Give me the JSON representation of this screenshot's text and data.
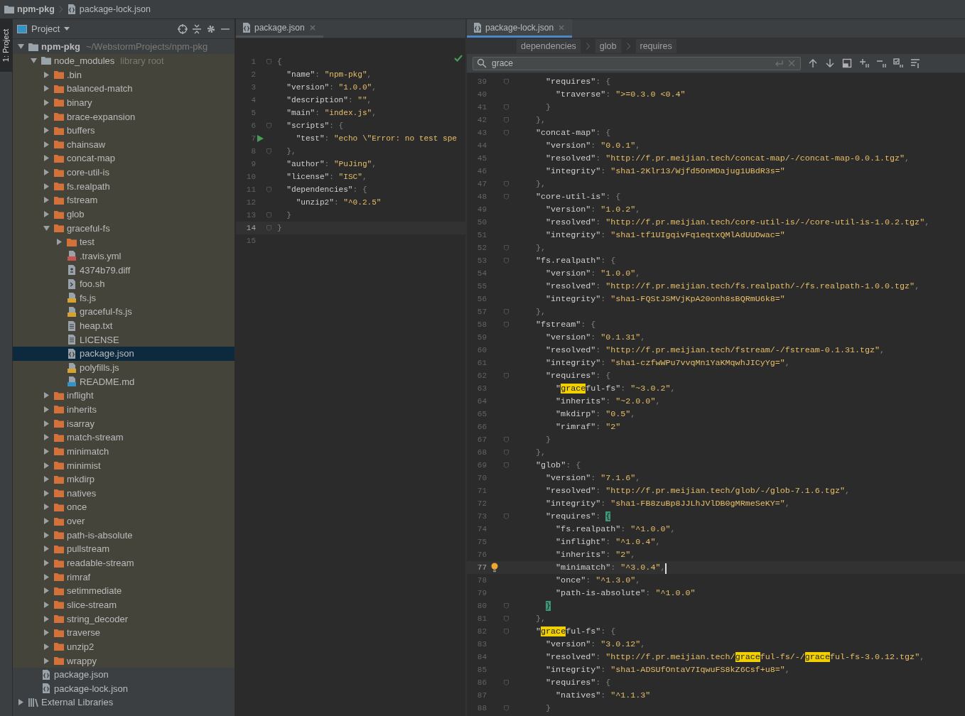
{
  "navigation_bar": {
    "items": [
      {
        "label": "npm-pkg",
        "kind": "folder"
      },
      {
        "label": "package-lock.json",
        "kind": "json"
      }
    ]
  },
  "tool_window_strip": {
    "label": "1: Project",
    "selected": true
  },
  "project_panel": {
    "title": "Project",
    "tree": [
      {
        "name": "npm-pkg",
        "hint": "~/WebstormProjects/npm-pkg",
        "kind": "project_folder",
        "expanded": true,
        "selected": false,
        "children": [
          {
            "name": "node_modules",
            "hint": "library root",
            "kind": "project_folder",
            "library": true,
            "expanded": true,
            "selected": false,
            "children": [
              {
                "name": ".bin",
                "kind": "folder",
                "expanded": false,
                "selected": false
              },
              {
                "name": "balanced-match",
                "kind": "folder",
                "expanded": false,
                "selected": false
              },
              {
                "name": "binary",
                "kind": "folder",
                "expanded": false,
                "selected": false
              },
              {
                "name": "brace-expansion",
                "kind": "folder",
                "expanded": false,
                "selected": false
              },
              {
                "name": "buffers",
                "kind": "folder",
                "expanded": false,
                "selected": false
              },
              {
                "name": "chainsaw",
                "kind": "folder",
                "expanded": false,
                "selected": false
              },
              {
                "name": "concat-map",
                "kind": "folder",
                "expanded": false,
                "selected": false
              },
              {
                "name": "core-util-is",
                "kind": "folder",
                "expanded": false,
                "selected": false
              },
              {
                "name": "fs.realpath",
                "kind": "folder",
                "expanded": false,
                "selected": false
              },
              {
                "name": "fstream",
                "kind": "folder",
                "expanded": false,
                "selected": false
              },
              {
                "name": "glob",
                "kind": "folder",
                "expanded": false,
                "selected": false
              },
              {
                "name": "graceful-fs",
                "kind": "folder",
                "expanded": true,
                "selected": false,
                "children": [
                  {
                    "name": "test",
                    "kind": "folder",
                    "expanded": false,
                    "selected": false
                  },
                  {
                    "name": ".travis.yml",
                    "kind": "yml",
                    "selected": false
                  },
                  {
                    "name": "4374b79.diff",
                    "kind": "diff",
                    "selected": false
                  },
                  {
                    "name": "foo.sh",
                    "kind": "shell",
                    "selected": false
                  },
                  {
                    "name": "fs.js",
                    "kind": "js",
                    "selected": false
                  },
                  {
                    "name": "graceful-fs.js",
                    "kind": "js",
                    "selected": false
                  },
                  {
                    "name": "heap.txt",
                    "kind": "text",
                    "selected": false
                  },
                  {
                    "name": "LICENSE",
                    "kind": "text",
                    "selected": false
                  },
                  {
                    "name": "package.json",
                    "kind": "json",
                    "selected": true
                  },
                  {
                    "name": "polyfills.js",
                    "kind": "js",
                    "selected": false
                  },
                  {
                    "name": "README.md",
                    "kind": "md",
                    "selected": false
                  }
                ]
              },
              {
                "name": "inflight",
                "kind": "folder",
                "expanded": false,
                "selected": false
              },
              {
                "name": "inherits",
                "kind": "folder",
                "expanded": false,
                "selected": false
              },
              {
                "name": "isarray",
                "kind": "folder",
                "expanded": false,
                "selected": false
              },
              {
                "name": "match-stream",
                "kind": "folder",
                "expanded": false,
                "selected": false
              },
              {
                "name": "minimatch",
                "kind": "folder",
                "expanded": false,
                "selected": false
              },
              {
                "name": "minimist",
                "kind": "folder",
                "expanded": false,
                "selected": false
              },
              {
                "name": "mkdirp",
                "kind": "folder",
                "expanded": false,
                "selected": false
              },
              {
                "name": "natives",
                "kind": "folder",
                "expanded": false,
                "selected": false
              },
              {
                "name": "once",
                "kind": "folder",
                "expanded": false,
                "selected": false
              },
              {
                "name": "over",
                "kind": "folder",
                "expanded": false,
                "selected": false
              },
              {
                "name": "path-is-absolute",
                "kind": "folder",
                "expanded": false,
                "selected": false
              },
              {
                "name": "pullstream",
                "kind": "folder",
                "expanded": false,
                "selected": false
              },
              {
                "name": "readable-stream",
                "kind": "folder",
                "expanded": false,
                "selected": false
              },
              {
                "name": "rimraf",
                "kind": "folder",
                "expanded": false,
                "selected": false
              },
              {
                "name": "setimmediate",
                "kind": "folder",
                "expanded": false,
                "selected": false
              },
              {
                "name": "slice-stream",
                "kind": "folder",
                "expanded": false,
                "selected": false
              },
              {
                "name": "string_decoder",
                "kind": "folder",
                "expanded": false,
                "selected": false
              },
              {
                "name": "traverse",
                "kind": "folder",
                "expanded": false,
                "selected": false
              },
              {
                "name": "unzip2",
                "kind": "folder",
                "expanded": false,
                "selected": false
              },
              {
                "name": "wrappy",
                "kind": "folder",
                "expanded": false,
                "selected": false
              }
            ]
          },
          {
            "name": "package.json",
            "kind": "json",
            "selected": false
          },
          {
            "name": "package-lock.json",
            "kind": "json",
            "selected": false
          }
        ]
      },
      {
        "name": "External Libraries",
        "kind": "libraries",
        "expanded": false,
        "selected": false
      }
    ]
  },
  "editors": [
    {
      "tab": {
        "label": "package.json",
        "selected": false
      },
      "inspection_passed": true,
      "lines": [
        {
          "number": "1",
          "text": "{",
          "fold": true,
          "current": false
        },
        {
          "number": "2",
          "text": "  \"name\": \"npm-pkg\",",
          "current": false
        },
        {
          "number": "3",
          "text": "  \"version\": \"1.0.0\",",
          "current": false
        },
        {
          "number": "4",
          "text": "  \"description\": \"\",",
          "current": false
        },
        {
          "number": "5",
          "text": "  \"main\": \"index.js\",",
          "current": false
        },
        {
          "number": "6",
          "text": "  \"scripts\": {",
          "fold": true,
          "current": false
        },
        {
          "number": "7",
          "text": "    \"test\": \"echo \\\"Error: no test spe",
          "run_marker": true,
          "current": false
        },
        {
          "number": "8",
          "text": "  },",
          "fold": true,
          "current": false
        },
        {
          "number": "9",
          "text": "  \"author\": \"PuJing\",",
          "current": false
        },
        {
          "number": "10",
          "text": "  \"license\": \"ISC\",",
          "current": false
        },
        {
          "number": "11",
          "text": "  \"dependencies\": {",
          "fold": true,
          "current": false
        },
        {
          "number": "12",
          "text": "    \"unzip2\": \"^0.2.5\"",
          "current": false
        },
        {
          "number": "13",
          "text": "  }",
          "fold": true,
          "current": false
        },
        {
          "number": "14",
          "text": "}",
          "fold": true,
          "current": true
        },
        {
          "number": "15",
          "current": false
        }
      ]
    },
    {
      "tab": {
        "label": "package-lock.json",
        "selected": true
      },
      "breadcrumbs": [
        "dependencies",
        "glob",
        "requires"
      ],
      "search": {
        "value": "grace"
      },
      "lines": [
        {
          "number": "39",
          "text": "      \"requires\": {",
          "fold": true,
          "current": false
        },
        {
          "number": "40",
          "text": "        \"traverse\": \">=0.3.0 <0.4\"",
          "current": false
        },
        {
          "number": "41",
          "text": "      }",
          "fold": true,
          "current": false
        },
        {
          "number": "42",
          "text": "    },",
          "fold": true,
          "current": false
        },
        {
          "number": "43",
          "text": "    \"concat-map\": {",
          "fold": true,
          "current": false
        },
        {
          "number": "44",
          "text": "      \"version\": \"0.0.1\",",
          "current": false
        },
        {
          "number": "45",
          "text": "      \"resolved\": \"http://f.pr.meijian.tech/concat-map/-/concat-map-0.0.1.tgz\",",
          "current": false
        },
        {
          "number": "46",
          "text": "      \"integrity\": \"sha1-2Klr13/Wjfd5OnMDajug1UBdR3s=\"",
          "current": false
        },
        {
          "number": "47",
          "text": "    },",
          "fold": true,
          "current": false
        },
        {
          "number": "48",
          "text": "    \"core-util-is\": {",
          "fold": true,
          "current": false
        },
        {
          "number": "49",
          "text": "      \"version\": \"1.0.2\",",
          "current": false
        },
        {
          "number": "50",
          "text": "      \"resolved\": \"http://f.pr.meijian.tech/core-util-is/-/core-util-is-1.0.2.tgz\",",
          "current": false
        },
        {
          "number": "51",
          "text": "      \"integrity\": \"sha1-tf1UIgqivFq1eqtxQMlAdUUDwac=\"",
          "current": false
        },
        {
          "number": "52",
          "text": "    },",
          "fold": true,
          "current": false
        },
        {
          "number": "53",
          "text": "    \"fs.realpath\": {",
          "fold": true,
          "current": false
        },
        {
          "number": "54",
          "text": "      \"version\": \"1.0.0\",",
          "current": false
        },
        {
          "number": "55",
          "text": "      \"resolved\": \"http://f.pr.meijian.tech/fs.realpath/-/fs.realpath-1.0.0.tgz\",",
          "current": false
        },
        {
          "number": "56",
          "text": "      \"integrity\": \"sha1-FQStJSMVjKpA20onh8sBQRmU6k8=\"",
          "current": false
        },
        {
          "number": "57",
          "text": "    },",
          "fold": true,
          "current": false
        },
        {
          "number": "58",
          "text": "    \"fstream\": {",
          "fold": true,
          "current": false
        },
        {
          "number": "59",
          "text": "      \"version\": \"0.1.31\",",
          "current": false
        },
        {
          "number": "60",
          "text": "      \"resolved\": \"http://f.pr.meijian.tech/fstream/-/fstream-0.1.31.tgz\",",
          "current": false
        },
        {
          "number": "61",
          "text": "      \"integrity\": \"sha1-czfwWPu7vvqMn1YaKMqwhJICyYg=\",",
          "current": false
        },
        {
          "number": "62",
          "text": "      \"requires\": {",
          "fold": true,
          "current": false
        },
        {
          "number": "63",
          "text": "        \"graceful-fs\": \"~3.0.2\",",
          "current": false
        },
        {
          "number": "64",
          "text": "        \"inherits\": \"~2.0.0\",",
          "current": false
        },
        {
          "number": "65",
          "text": "        \"mkdirp\": \"0.5\",",
          "current": false
        },
        {
          "number": "66",
          "text": "        \"rimraf\": \"2\"",
          "current": false
        },
        {
          "number": "67",
          "text": "      }",
          "fold": true,
          "current": false
        },
        {
          "number": "68",
          "text": "    },",
          "fold": true,
          "current": false
        },
        {
          "number": "69",
          "text": "    \"glob\": {",
          "fold": true,
          "current": false
        },
        {
          "number": "70",
          "text": "      \"version\": \"7.1.6\",",
          "current": false
        },
        {
          "number": "71",
          "text": "      \"resolved\": \"http://f.pr.meijian.tech/glob/-/glob-7.1.6.tgz\",",
          "current": false
        },
        {
          "number": "72",
          "text": "      \"integrity\": \"sha1-FB8zuBp8JJLhJVlDB0gMRmeSeKY=\",",
          "current": false
        },
        {
          "number": "73",
          "text": "      \"requires\": {",
          "fold": true,
          "bracket_match": true,
          "current": false
        },
        {
          "number": "74",
          "text": "        \"fs.realpath\": \"^1.0.0\",",
          "current": false
        },
        {
          "number": "75",
          "text": "        \"inflight\": \"^1.0.4\",",
          "current": false
        },
        {
          "number": "76",
          "text": "        \"inherits\": \"2\",",
          "current": false
        },
        {
          "number": "77",
          "text": "        \"minimatch\": \"^3.0.4\",",
          "bulb": true,
          "caret": true,
          "current": true
        },
        {
          "number": "78",
          "text": "        \"once\": \"^1.3.0\",",
          "current": false
        },
        {
          "number": "79",
          "text": "        \"path-is-absolute\": \"^1.0.0\"",
          "current": false
        },
        {
          "number": "80",
          "text": "      }",
          "fold": true,
          "bracket_match": true,
          "current": false
        },
        {
          "number": "81",
          "text": "    },",
          "fold": true,
          "current": false
        },
        {
          "number": "82",
          "text": "    \"graceful-fs\": {",
          "fold": true,
          "current": false
        },
        {
          "number": "83",
          "text": "      \"version\": \"3.0.12\",",
          "current": false
        },
        {
          "number": "84",
          "text": "      \"resolved\": \"http://f.pr.meijian.tech/graceful-fs/-/graceful-fs-3.0.12.tgz\",",
          "current": false
        },
        {
          "number": "85",
          "text": "      \"integrity\": \"sha1-ADSUfOntaV7IqwuFS8kZ6Csf+u8=\",",
          "current": false
        },
        {
          "number": "86",
          "text": "      \"requires\": {",
          "fold": true,
          "current": false
        },
        {
          "number": "87",
          "text": "        \"natives\": \"^1.1.3\"",
          "current": false
        },
        {
          "number": "88",
          "text": "      }",
          "fold": true,
          "current": false
        }
      ]
    }
  ]
}
